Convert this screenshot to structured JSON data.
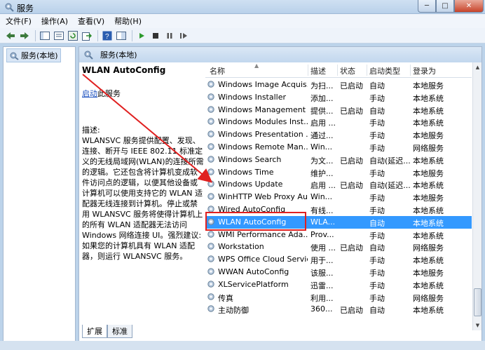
{
  "window": {
    "title": "服务",
    "min": "─",
    "max": "□",
    "close": "✕"
  },
  "menu": [
    "文件(F)",
    "操作(A)",
    "查看(V)",
    "帮助(H)"
  ],
  "tree": {
    "root": "服务(本地)"
  },
  "main": {
    "header": "服务(本地)",
    "selected_service": "WLAN AutoConfig",
    "start_link": "启动",
    "start_suffix": "此服务",
    "desc_label": "描述:",
    "description": "WLANSVC 服务提供配置、发现、连接、断开与 IEEE 802.11 标准定义的无线局域网(WLAN)的连接所需的逻辑。它还包含将计算机变成软件访问点的逻辑，以便其他设备或计算机可以使用支持它的 WLAN 适配器无线连接到计算机。停止或禁用 WLANSVC 服务将使得计算机上的所有 WLAN 适配器无法访问 Windows 网络连接 UI。强烈建议: 如果您的计算机具有 WLAN 适配器，则运行 WLANSVC 服务。"
  },
  "table": {
    "columns": [
      "名称",
      "描述",
      "状态",
      "启动类型",
      "登录为"
    ],
    "rows": [
      [
        "Windows Image Acquis...",
        "为扫...",
        "已启动",
        "自动",
        "本地服务"
      ],
      [
        "Windows Installer",
        "添加...",
        "",
        "手动",
        "本地系统"
      ],
      [
        "Windows Management ...",
        "提供...",
        "已启动",
        "自动",
        "本地系统"
      ],
      [
        "Windows Modules Inst...",
        "启用 ...",
        "",
        "手动",
        "本地系统"
      ],
      [
        "Windows Presentation ...",
        "通过...",
        "",
        "手动",
        "本地服务"
      ],
      [
        "Windows Remote Man...",
        "Win...",
        "",
        "手动",
        "网络服务"
      ],
      [
        "Windows Search",
        "为文...",
        "已启动",
        "自动(延迟...",
        "本地系统"
      ],
      [
        "Windows Time",
        "维护...",
        "",
        "手动",
        "本地服务"
      ],
      [
        "Windows Update",
        "启用 ...",
        "已启动",
        "自动(延迟...",
        "本地系统"
      ],
      [
        "WinHTTP Web Proxy Au...",
        "Win...",
        "",
        "手动",
        "本地服务"
      ],
      [
        "Wired AutoConfig",
        "有线...",
        "",
        "手动",
        "本地系统"
      ],
      [
        "WLAN AutoConfig",
        "WLA...",
        "",
        "自动",
        "本地系统"
      ],
      [
        "WMI Performance Ada...",
        "Prov...",
        "",
        "手动",
        "本地系统"
      ],
      [
        "Workstation",
        "使用 ...",
        "已启动",
        "自动",
        "网络服务"
      ],
      [
        "WPS Office Cloud Service",
        "用于...",
        "",
        "手动",
        "本地系统"
      ],
      [
        "WWAN AutoConfig",
        "该服...",
        "",
        "手动",
        "本地服务"
      ],
      [
        "XLServicePlatform",
        "迅雷...",
        "",
        "手动",
        "本地系统"
      ],
      [
        "传真",
        "利用...",
        "",
        "手动",
        "网络服务"
      ],
      [
        "主动防御",
        "360...",
        "已启动",
        "自动",
        "本地系统"
      ]
    ],
    "selected_index": 11
  },
  "tabs": [
    "扩展",
    "标准"
  ],
  "colors": {
    "selection": "#3399ff",
    "annotation": "#e02020",
    "link": "#1a4fbf"
  }
}
